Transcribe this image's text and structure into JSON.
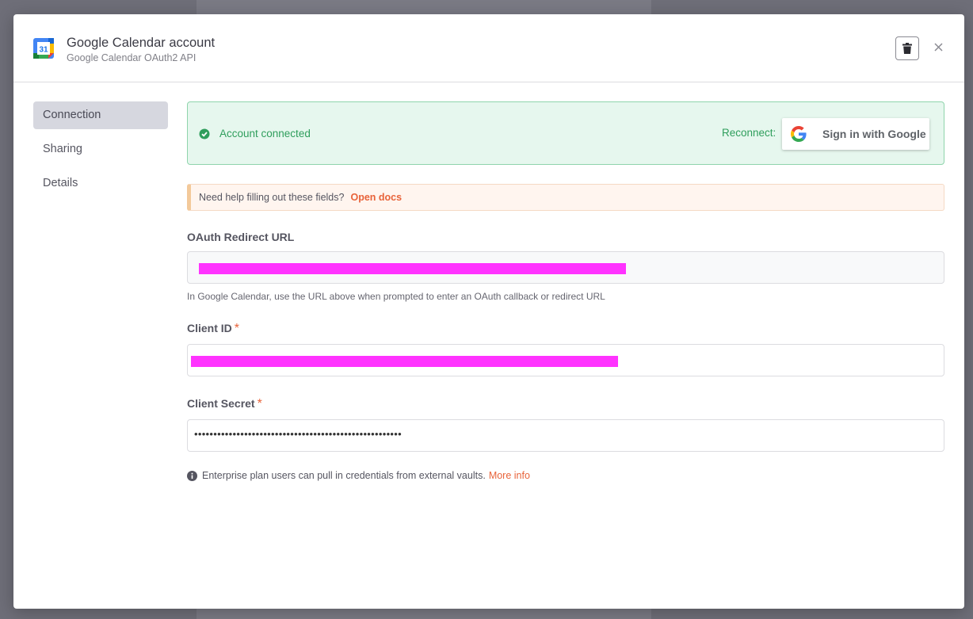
{
  "header": {
    "title": "Google Calendar account",
    "subtitle": "Google Calendar OAuth2 API",
    "app_icon_text": "31"
  },
  "sidebar": {
    "items": [
      {
        "label": "Connection",
        "active": true
      },
      {
        "label": "Sharing",
        "active": false
      },
      {
        "label": "Details",
        "active": false
      }
    ]
  },
  "status": {
    "connected_text": "Account connected",
    "reconnect_label": "Reconnect:",
    "google_button_label": "Sign in with Google"
  },
  "help": {
    "text": "Need help filling out these fields?",
    "link": "Open docs"
  },
  "fields": {
    "redirect": {
      "label": "OAuth Redirect URL",
      "hint": "In Google Calendar, use the URL above when prompted to enter an OAuth callback or redirect URL"
    },
    "client_id": {
      "label": "Client ID",
      "required": "*"
    },
    "client_secret": {
      "label": "Client Secret",
      "required": "*",
      "value": "••••••••••••••••••••••••••••••••••••••••••••••••••••••"
    }
  },
  "info": {
    "text": "Enterprise plan users can pull in credentials from external vaults.",
    "link": "More info"
  },
  "colors": {
    "accent": "#e8633a",
    "success": "#2f9e5c",
    "redaction": "#ff33ff"
  },
  "icons": {
    "delete": "trash-icon",
    "close": "close-icon",
    "check": "check-circle-icon",
    "info": "info-circle-icon",
    "google": "google-g-logo",
    "app": "google-calendar-icon"
  }
}
